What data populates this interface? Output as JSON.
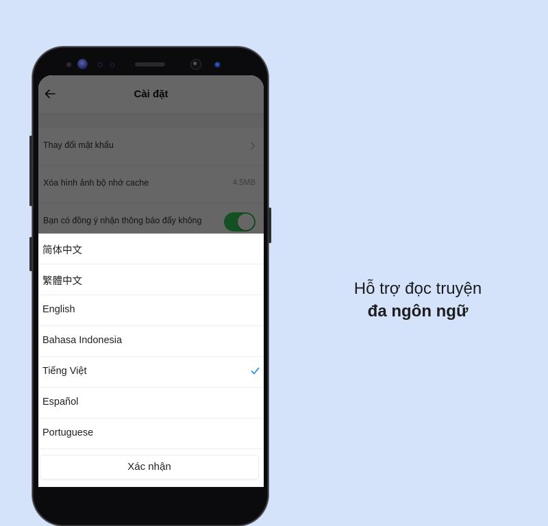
{
  "settings": {
    "title": "Cài đặt",
    "rows": [
      {
        "label": "Thay đổi mật khẩu",
        "type": "chevron"
      },
      {
        "label": "Xóa hình ảnh bộ nhớ cache",
        "value": "4.5MB"
      },
      {
        "label": "Bạn có đồng ý nhận thông báo đẩy không",
        "toggle_on": true
      }
    ]
  },
  "language_sheet": {
    "options": [
      {
        "label": "简体中文",
        "selected": false
      },
      {
        "label": "繁體中文",
        "selected": false
      },
      {
        "label": "English",
        "selected": false
      },
      {
        "label": "Bahasa Indonesia",
        "selected": false
      },
      {
        "label": "Tiếng Việt",
        "selected": true
      },
      {
        "label": "Español",
        "selected": false
      },
      {
        "label": "Portuguese",
        "selected": false
      }
    ],
    "confirm_label": "Xác nhận"
  },
  "caption": {
    "line1": "Hỗ trợ đọc truyện",
    "line2": "đa ngôn ngữ"
  },
  "colors": {
    "background": "#d4e3fa",
    "toggle_on": "#34c759",
    "check": "#1e88e5"
  }
}
